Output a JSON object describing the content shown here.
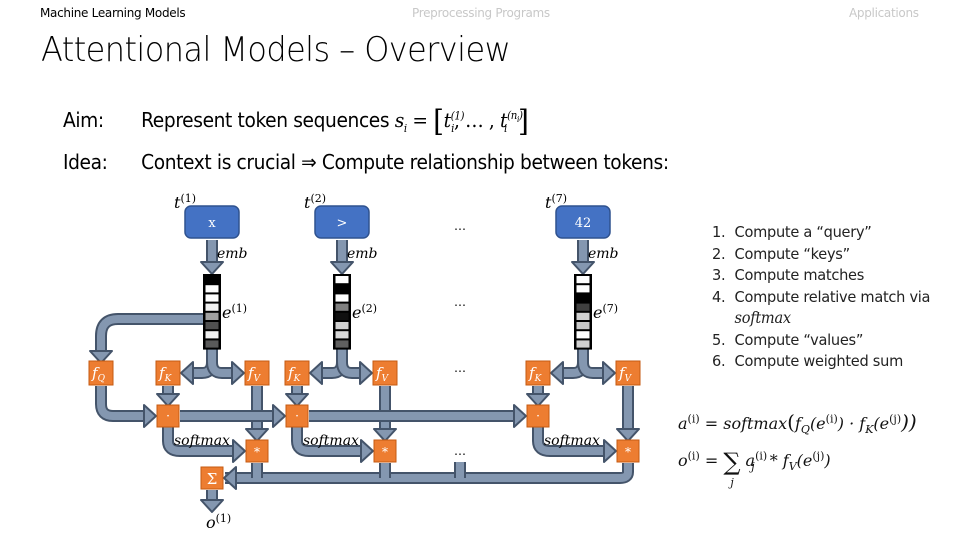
{
  "header": {
    "nav": [
      {
        "label": "Machine Learning Models",
        "state": "active"
      },
      {
        "label": "Preprocessing Programs",
        "state": "inactive"
      },
      {
        "label": "Applications",
        "state": "inactive"
      }
    ],
    "title": "Attentional Models – Overview"
  },
  "body": {
    "aim": {
      "label": "Aim:",
      "text": "Represent token sequences",
      "math_lhs": "s",
      "math_lhs_sub": "i",
      "eq": "=",
      "first": "t",
      "first_sub": "i",
      "first_sup": "(1)",
      "sep": ",  … ,",
      "last": "t",
      "last_sub": "i",
      "last_sup": "(n",
      "last_sup_sub": "i",
      "last_sup_close": ")"
    },
    "idea": {
      "label": "Idea:",
      "text": "Context is crucial ⇒ Compute relationship between tokens:"
    }
  },
  "diagram": {
    "tokens": [
      {
        "label": "t",
        "index": "(1)",
        "value": "x",
        "embedding_label": "e",
        "embedding_index": "(1)",
        "embedding_shades": [
          "#000000",
          "#ffffff",
          "#ffffff",
          "#f0f0f0",
          "#a0a0a0",
          "#505050",
          "#f0f0f0",
          "#5a5a5a"
        ]
      },
      {
        "label": "t",
        "index": "(2)",
        "value": ">",
        "embedding_label": "e",
        "embedding_index": "(2)",
        "embedding_shades": [
          "#ffffff",
          "#000000",
          "#ffffff",
          "#808080",
          "#101010",
          "#d0d0d0",
          "#d8d8d8",
          "#606060"
        ]
      },
      {
        "label": "t",
        "index": "(7)",
        "value": "42",
        "embedding_label": "e",
        "embedding_index": "(7)",
        "embedding_shades": [
          "#ffffff",
          "#ffffff",
          "#000000",
          "#404040",
          "#d0d0d0",
          "#c8c8c8",
          "#ffffff",
          "#d0d0d0"
        ]
      }
    ],
    "emb_label": "emb",
    "ellipsis": "…",
    "fq": "f",
    "fq_sub": "Q",
    "fk": "f",
    "fk_sub": "K",
    "fv": "f",
    "fv_sub": "V",
    "dot_op": "·",
    "mul_op": "*",
    "sum_op": "Σ",
    "softmax_label": "softmax",
    "output_label": "o",
    "output_index": "(1)",
    "colors": {
      "token_box": "#4472c4",
      "op_box": "#ed7d31",
      "pipe_fill": "#8497b0",
      "pipe_stroke": "#44546a"
    }
  },
  "steps": [
    {
      "num": "1.",
      "text": "Compute a “query”"
    },
    {
      "num": "2.",
      "text": "Compute “keys”"
    },
    {
      "num": "3.",
      "text": "Compute matches"
    },
    {
      "num": "4.",
      "text": "Compute relative match via"
    },
    {
      "num": "",
      "text": "softmax",
      "italic": true
    },
    {
      "num": "5.",
      "text": "Compute “values”"
    },
    {
      "num": "6.",
      "text": "Compute weighted sum"
    }
  ],
  "formulas": {
    "a": "a⁽ⁱ⁾ = softmax(f_Q(e⁽ⁱ⁾) · f_K(e⁽ʲ⁾))",
    "a_parts": {
      "lhs": "a",
      "sup": "(i)",
      "eq": " = softmax",
      "open": "(",
      "fq": "f",
      "fq_sub": "Q",
      "arg1": "(e",
      "arg1_sup": "(i)",
      "mid": ") · ",
      "fk": "f",
      "fk_sub": "K",
      "arg2": "(e",
      "arg2_sup": "(j)",
      "close": "))"
    },
    "o_parts": {
      "lhs": "o",
      "sup": "(i)",
      "eq": " = ",
      "sum": "∑",
      "sum_sub": "j",
      "a": " a",
      "a_sub": "j",
      "a_sup": "(i)",
      "mul": " * ",
      "fv": "f",
      "fv_sub": "V",
      "arg": "(e",
      "arg_sup": "(j)",
      "close": ")"
    }
  }
}
